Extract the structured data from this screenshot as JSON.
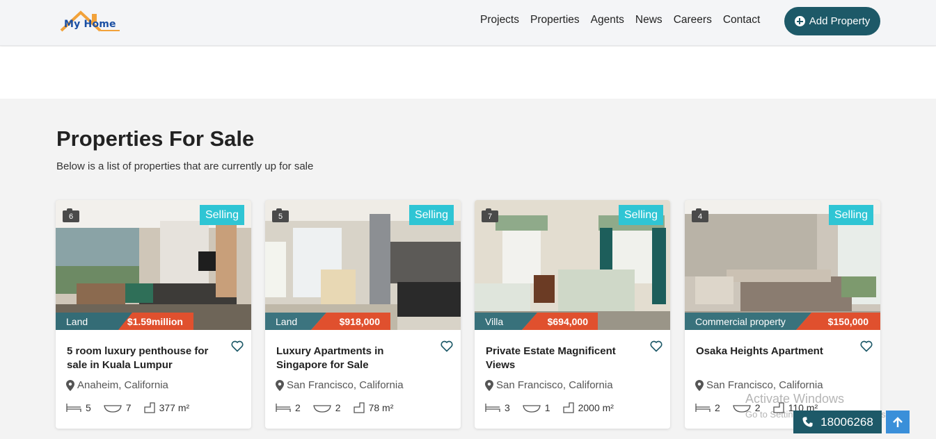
{
  "header": {
    "logo_text": "My Home",
    "nav": [
      "Projects",
      "Properties",
      "Agents",
      "News",
      "Careers",
      "Contact"
    ],
    "add_property": "Add Property"
  },
  "section": {
    "title": "Properties For Sale",
    "subtitle": "Below is a list of properties that are currently up for sale"
  },
  "cards": [
    {
      "photos": "6",
      "status": "Selling",
      "type": "Land",
      "price": "$1.59million",
      "title": "5 room luxury penthouse for sale in Kuala Lumpur",
      "location": "Anaheim, California",
      "beds": "5",
      "baths": "7",
      "area": "377 m²"
    },
    {
      "photos": "5",
      "status": "Selling",
      "type": "Land",
      "price": "$918,000",
      "title": "Luxury Apartments in Singapore for Sale",
      "location": "San Francisco, California",
      "beds": "2",
      "baths": "2",
      "area": "78 m²"
    },
    {
      "photos": "7",
      "status": "Selling",
      "type": "Villa",
      "price": "$694,000",
      "title": "Private Estate Magnificent Views",
      "location": "San Francisco, California",
      "beds": "3",
      "baths": "1",
      "area": "2000 m²"
    },
    {
      "photos": "4",
      "status": "Selling",
      "type": "Commercial property",
      "price": "$150,000",
      "title": "Osaka Heights Apartment",
      "location": "San Francisco, California",
      "beds": "2",
      "baths": "2",
      "area": "110 m²"
    }
  ],
  "floating": {
    "phone": "18006268"
  },
  "watermark": {
    "line1": "Activate Windows",
    "line2": "Go to Settings to activate Windows."
  },
  "colors": {
    "accent": "#1d5968",
    "selling": "#2fc5d4",
    "price_ribbon": "#e0502e",
    "type_ribbon": "#2d6d7a"
  }
}
